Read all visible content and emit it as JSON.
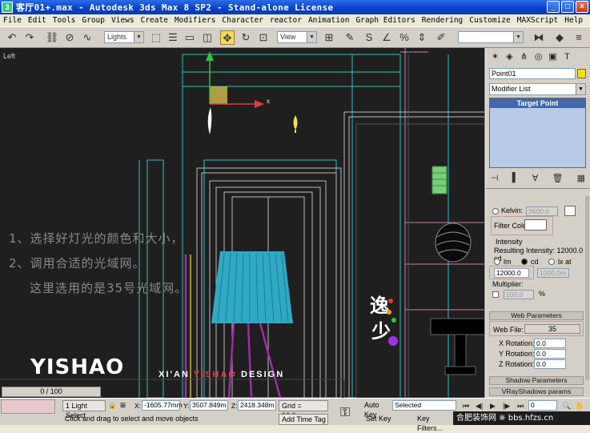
{
  "window": {
    "title": "客厅01+.max - Autodesk 3ds Max 8 SP2  - Stand-alone License",
    "app_icon": "3"
  },
  "menu": [
    "File",
    "Edit",
    "Tools",
    "Group",
    "Views",
    "Create",
    "Modifiers",
    "Character",
    "reactor",
    "Animation",
    "Graph Editors",
    "Rendering",
    "Customize",
    "MAXScript",
    "Help"
  ],
  "toolbar": {
    "selection_filter": "Lights",
    "ref_coord": "View"
  },
  "viewport": {
    "label": "Left",
    "annotations": [
      "1、选择好灯光的颜色和大小，",
      "2、调用合适的光域网。",
      "这里选用的是35号光域网。"
    ],
    "brand": {
      "yishao": "YISHAO",
      "xian_prefix": "XI'AN ",
      "xian_red": "YISHAO",
      "xian_suffix": " DESIGN",
      "gizmo_axis": "x"
    }
  },
  "command_panel": {
    "object_name": "Point01",
    "object_color": "#f5e100",
    "modifier_list": "Modifier List",
    "stack_item": "Target Point",
    "kelvin_label": "Kelvin:",
    "kelvin_value": "3600.0",
    "filter_color_label": "Filter Color:",
    "intensity_label": "Intensity",
    "resulting_intensity": "Resulting Intensity: 12000.0 cd",
    "unit_lm": "lm",
    "unit_cd": "cd",
    "unit_lxat": "lx at",
    "intensity_value": "12000.0",
    "distance_value": "1000.0m",
    "multiplier_label": "Multiplier:",
    "multiplier_value": "100.0",
    "percent": "%",
    "web_params_title": "Web Parameters",
    "web_file_label": "Web File:",
    "web_file_value": "35",
    "x_rot_label": "X Rotation:",
    "x_rot_value": "0.0",
    "y_rot_label": "Y Rotation:",
    "y_rot_value": "0.0",
    "z_rot_label": "Z Rotation:",
    "z_rot_value": "0.0",
    "shadow_params_title": "Shadow Parameters",
    "vray_shadow_title": "VRayShadows params"
  },
  "bottom": {
    "time_slider": "0 / 100",
    "selection_status": "1 Light Select",
    "prompt": "Click and drag to select and move objects",
    "x_label": "X:",
    "x_value": "-1605.77mm",
    "y_label": "Y:",
    "y_value": "3507.849m",
    "z_label": "Z:",
    "z_value": "2418.348m",
    "grid": "Grid = 10.0mm",
    "add_time_tag": "Add Time Tag",
    "auto_key": "Auto Key",
    "selected": "Selected",
    "set_key": "Set Key",
    "key_filters": "Key Filters...",
    "frame": "0",
    "watermark": "合肥装饰网 ※ bbs.hfzs.cn"
  }
}
